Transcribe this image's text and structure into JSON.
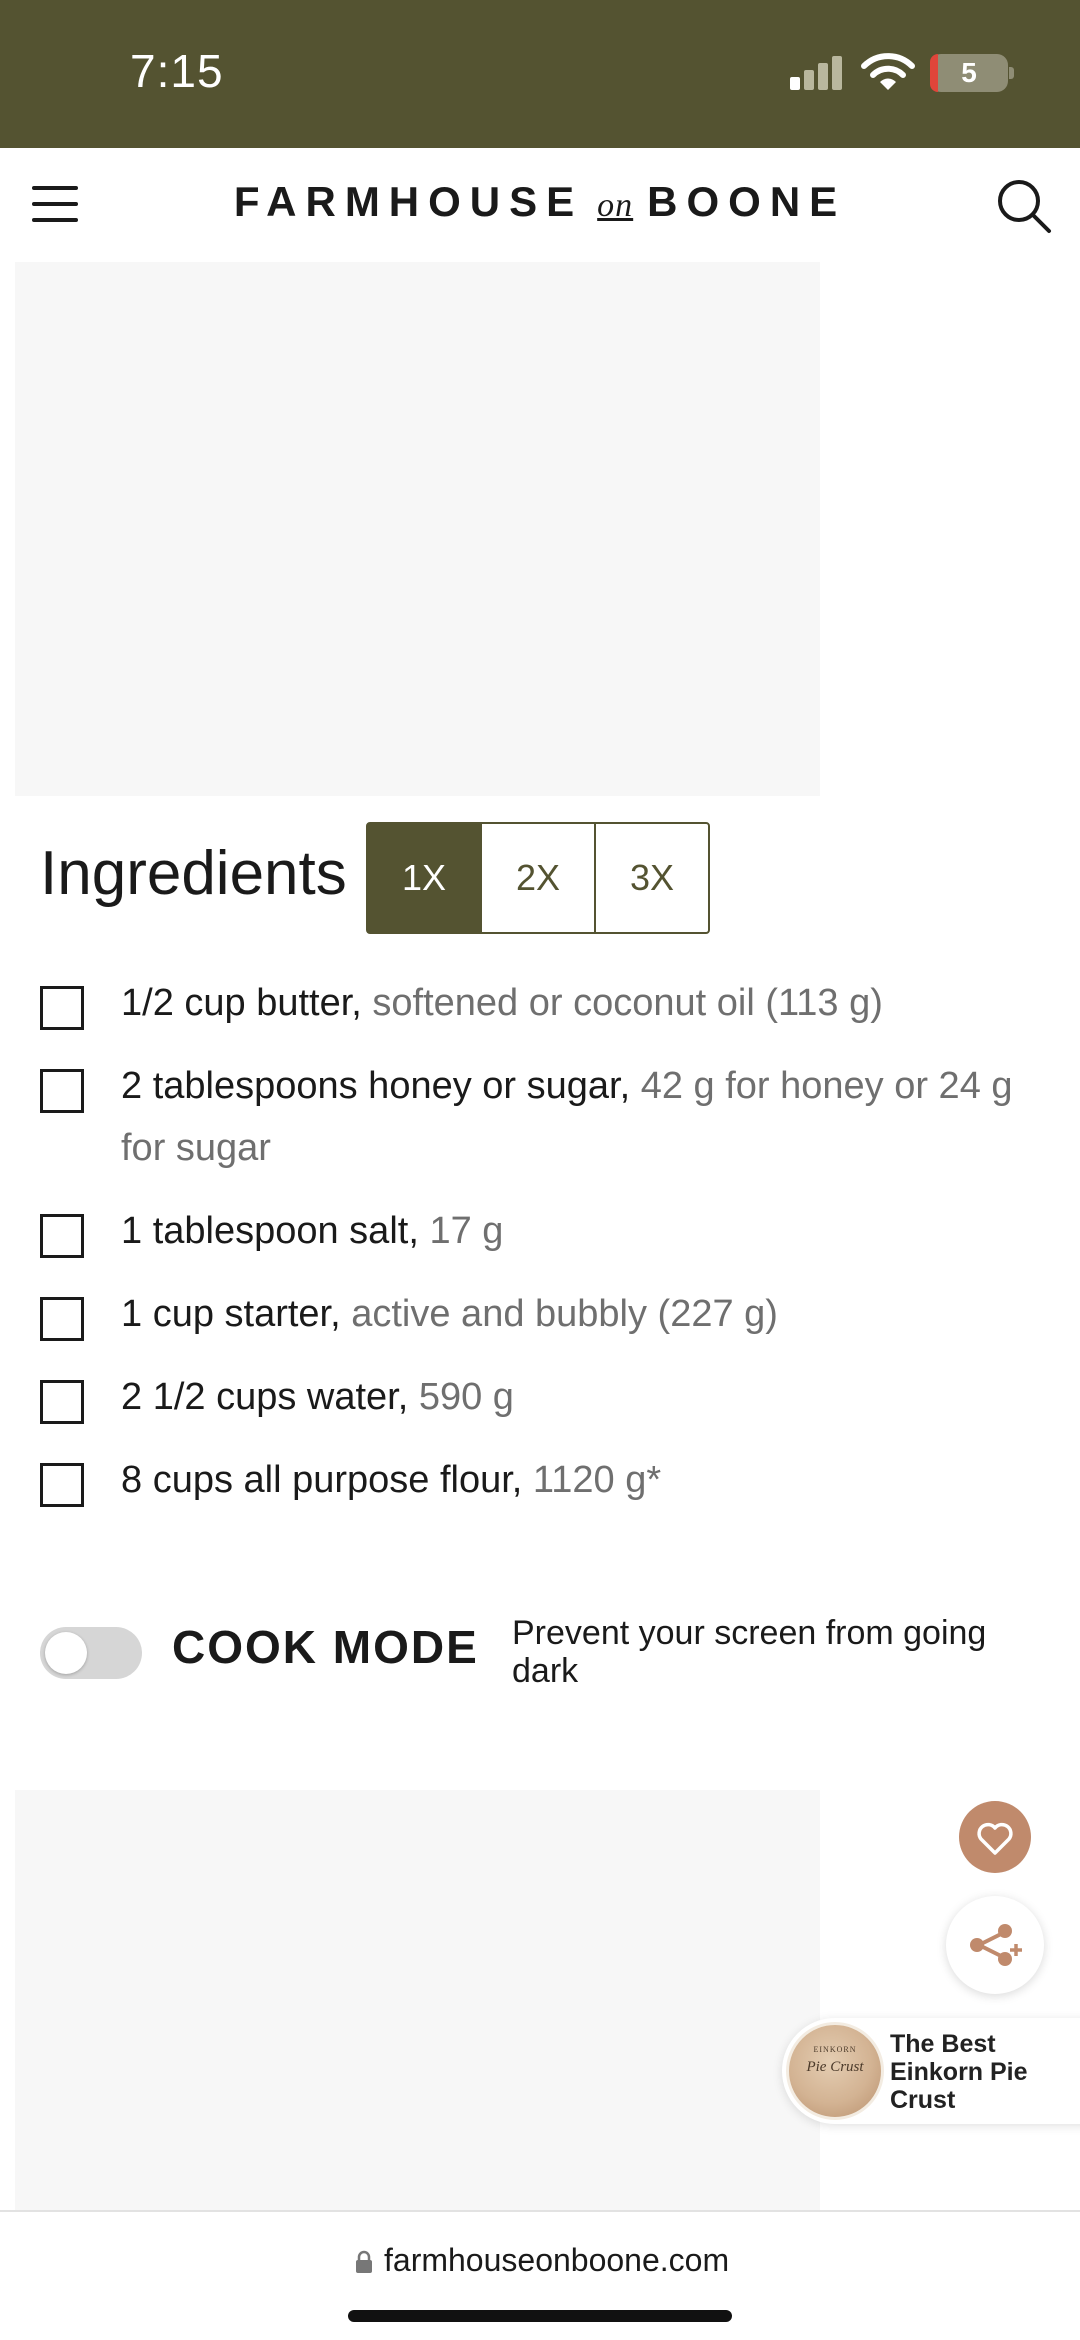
{
  "status_bar": {
    "time": "7:15",
    "battery_level": "5",
    "signal_bars_active": 1,
    "signal_bars_total": 4,
    "background_color": "#545331"
  },
  "header": {
    "logo_left": "FARMHOUSE",
    "logo_on": "on",
    "logo_right": "BOONE",
    "menu_icon": "hamburger-menu-icon",
    "search_icon": "search-icon"
  },
  "ingredients": {
    "title": "Ingredients",
    "scale_options": [
      "1X",
      "2X",
      "3X"
    ],
    "selected_scale": "1X",
    "items": [
      {
        "main": "1/2 cup butter, ",
        "note": "softened or coconut oil (113 g)"
      },
      {
        "main": "2 tablespoons honey or sugar, ",
        "note": "42 g for honey or 24 g for sugar"
      },
      {
        "main": "1 tablespoon salt, ",
        "note": "17 g"
      },
      {
        "main": "1 cup starter, ",
        "note": "active and bubbly (227 g)"
      },
      {
        "main": "2 1/2 cups water, ",
        "note": "590 g"
      },
      {
        "main": "8 cups all purpose flour, ",
        "note": "1120 g*"
      }
    ]
  },
  "cook_mode": {
    "label": "COOK MODE",
    "description": "Prevent your screen from going dark",
    "enabled": false
  },
  "floating": {
    "favorite_icon": "heart-icon",
    "share_icon": "share-plus-icon",
    "accent_color": "#c08a6c"
  },
  "related": {
    "title": "The Best Einkorn Pie Crust",
    "thumb_caps": "EINKORN",
    "thumb_script": "Pie Crust"
  },
  "browser": {
    "url": "farmhouseonboone.com"
  }
}
